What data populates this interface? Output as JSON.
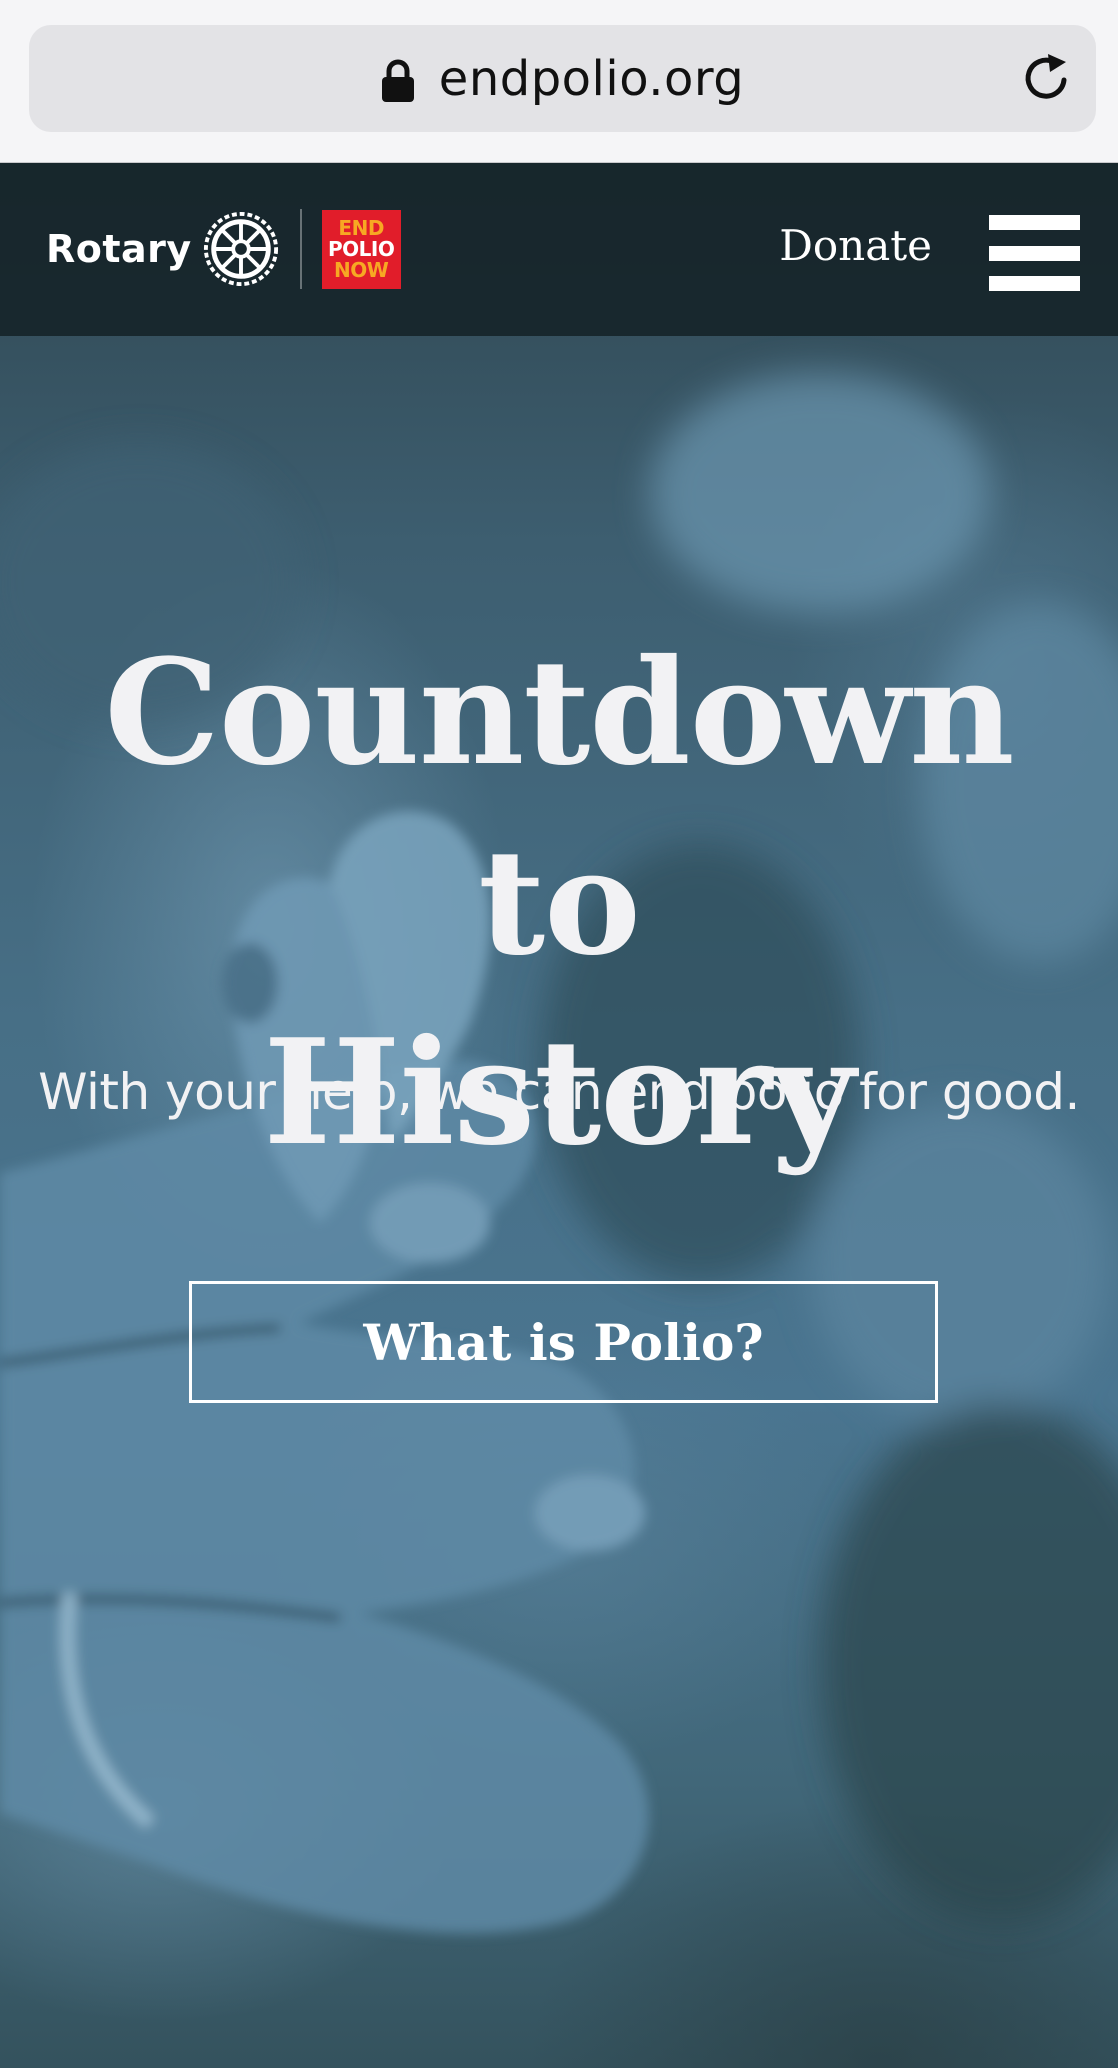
{
  "browser": {
    "url": "endpolio.org",
    "lock_icon": "lock-icon",
    "reload_icon": "reload-icon"
  },
  "header": {
    "rotary_logo_text": "Rotary",
    "rotary_emblem_icon": "rotary-wheel-icon",
    "endpolio_logo_lines": [
      "END",
      "POLIO",
      "NOW"
    ],
    "donate_label": "Donate",
    "menu_icon": "hamburger-menu-icon"
  },
  "hero": {
    "title_line1": "Countdown to",
    "title_line2": "History",
    "subtitle": "With your help, we can end polio for good.",
    "cta_label": "What is Polio?",
    "background_image": "hands-holding-baby-fingers-photo"
  },
  "colors": {
    "header_bg": "#142226",
    "hero_tint": "#476f86",
    "epn_red": "#e11d2a",
    "epn_orange": "#f7a823",
    "text_light": "#f2f2f4"
  }
}
